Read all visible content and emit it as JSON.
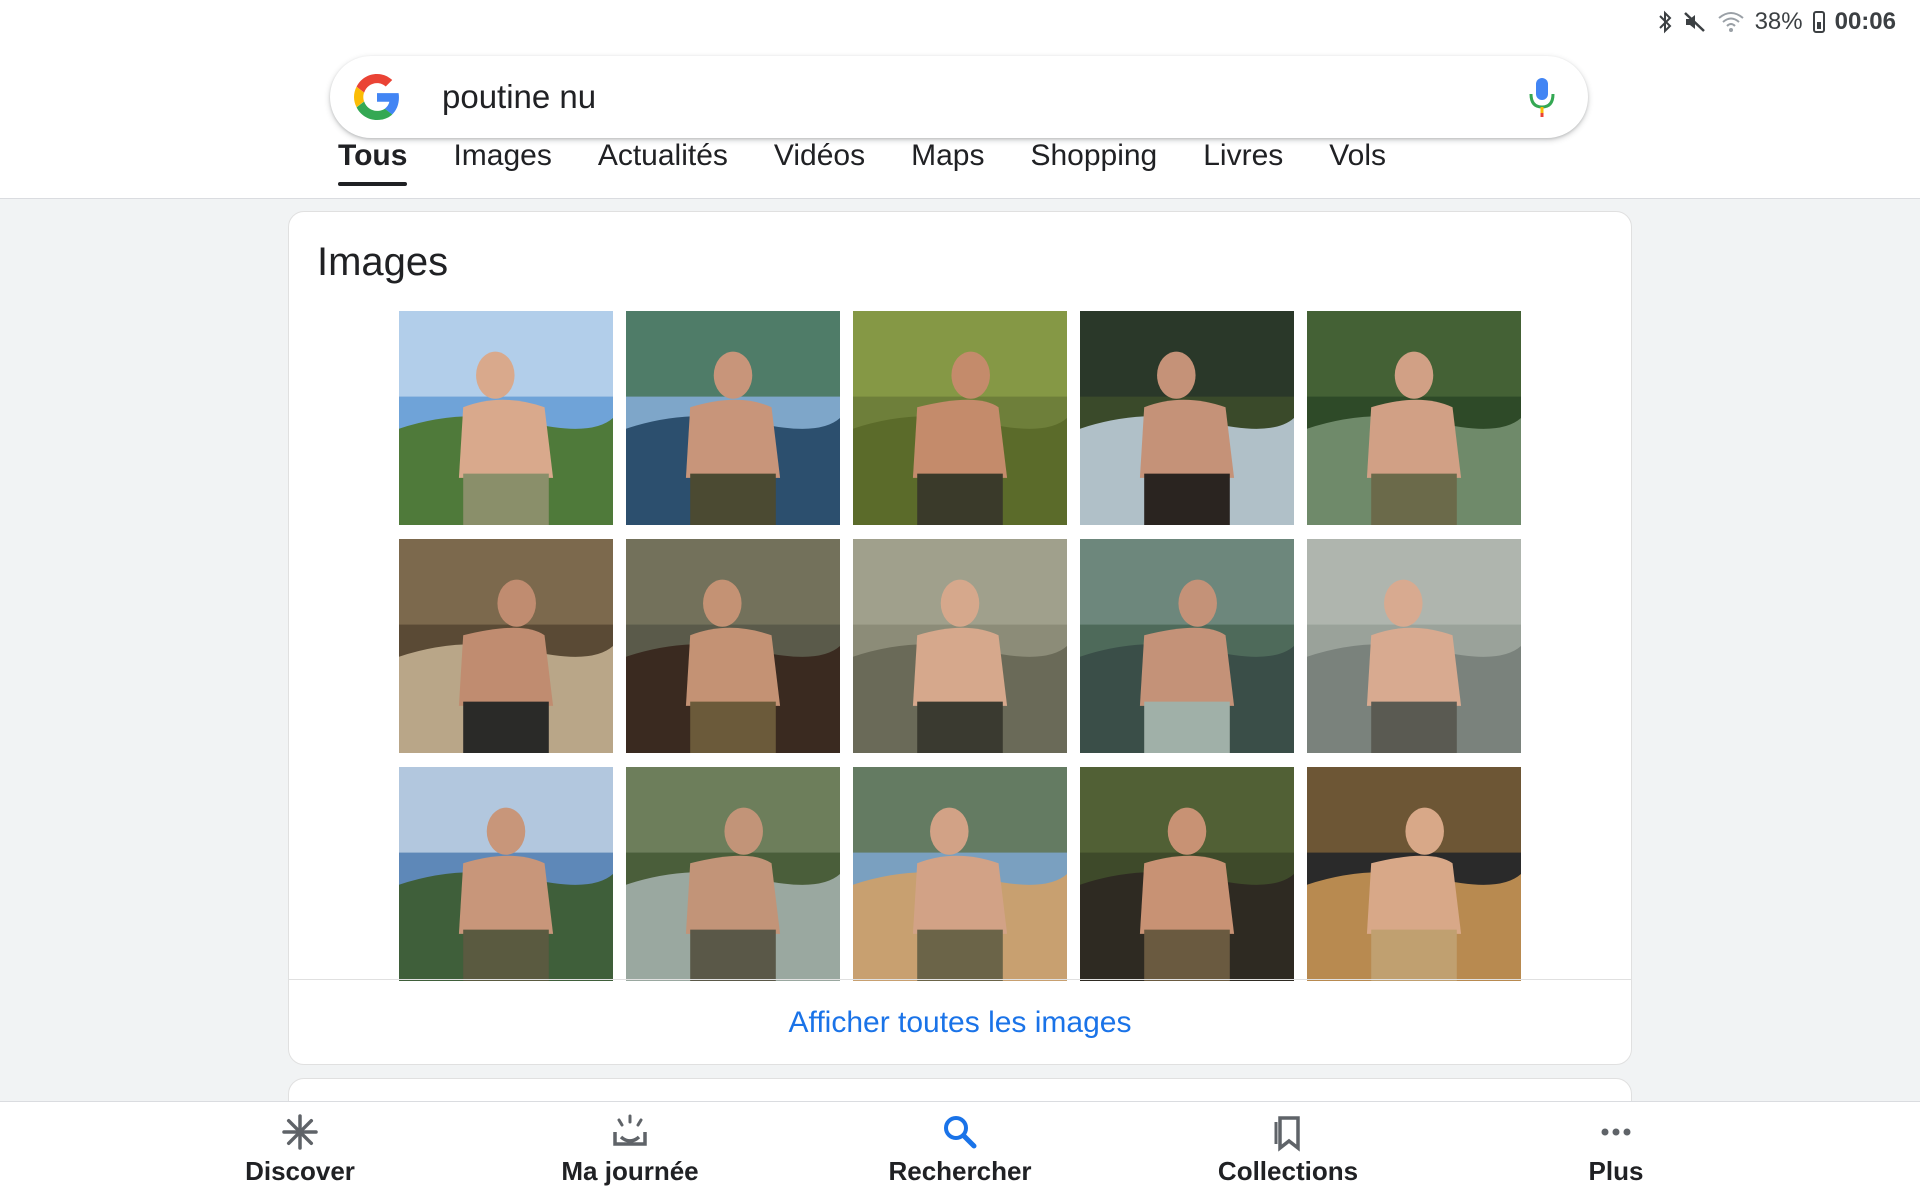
{
  "status_bar": {
    "battery_percent": "38%",
    "time": "00:06",
    "icons": [
      "bluetooth-icon",
      "mute-icon",
      "wifi-icon",
      "battery-icon"
    ]
  },
  "search": {
    "query": "poutine nu",
    "logo_icon": "google-g-icon",
    "mic_icon": "microphone-icon"
  },
  "tabs": [
    {
      "label": "Tous",
      "active": true
    },
    {
      "label": "Images",
      "active": false
    },
    {
      "label": "Actualités",
      "active": false
    },
    {
      "label": "Vidéos",
      "active": false
    },
    {
      "label": "Maps",
      "active": false
    },
    {
      "label": "Shopping",
      "active": false
    },
    {
      "label": "Livres",
      "active": false
    },
    {
      "label": "Vols",
      "active": false
    }
  ],
  "images_card": {
    "title": "Images",
    "show_all_label": "Afficher toutes les images",
    "thumbnail_count": 15
  },
  "bottom_nav": [
    {
      "label": "Discover",
      "icon": "asterisk-icon"
    },
    {
      "label": "Ma journée",
      "icon": "sunrise-icon"
    },
    {
      "label": "Rechercher",
      "icon": "search-icon",
      "active": true
    },
    {
      "label": "Collections",
      "icon": "bookmark-icon"
    },
    {
      "label": "Plus",
      "icon": "more-icon"
    }
  ],
  "colors": {
    "link_blue": "#1a73e8",
    "page_bg": "#f1f3f4",
    "active_nav": "#1a73e8"
  }
}
